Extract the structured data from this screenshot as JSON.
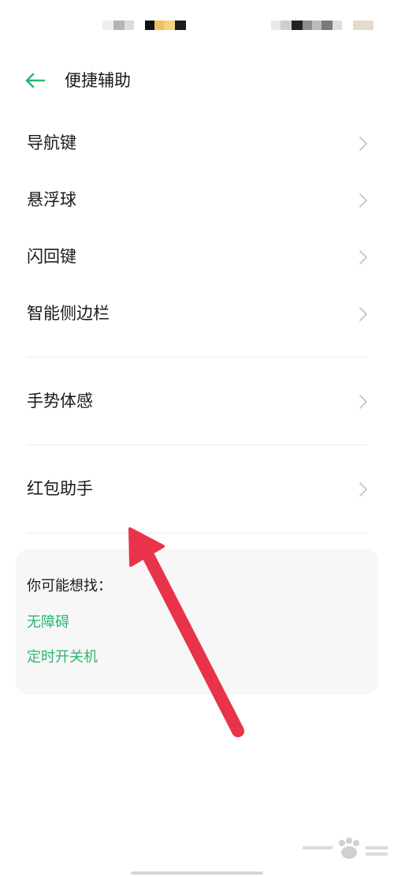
{
  "header": {
    "back_icon": "back-arrow-icon",
    "title": "便捷辅助"
  },
  "menu": {
    "items": [
      {
        "label": "导航键",
        "icon": "chevron-right-icon"
      },
      {
        "label": "悬浮球",
        "icon": "chevron-right-icon"
      },
      {
        "label": "闪回键",
        "icon": "chevron-right-icon"
      },
      {
        "label": "智能侧边栏",
        "icon": "chevron-right-icon"
      },
      {
        "label": "手势体感",
        "icon": "chevron-right-icon"
      },
      {
        "label": "红包助手",
        "icon": "chevron-right-icon"
      }
    ]
  },
  "suggestions": {
    "heading": "你可能想找：",
    "links": [
      "无障碍",
      "定时开关机"
    ]
  },
  "colors": {
    "accent": "#2bb673",
    "annotation_arrow": "#e8334a",
    "divider": "#ececec",
    "card_bg": "#f7f7f7"
  },
  "watermark": {
    "logo": "baidu-jingyan-logo"
  }
}
